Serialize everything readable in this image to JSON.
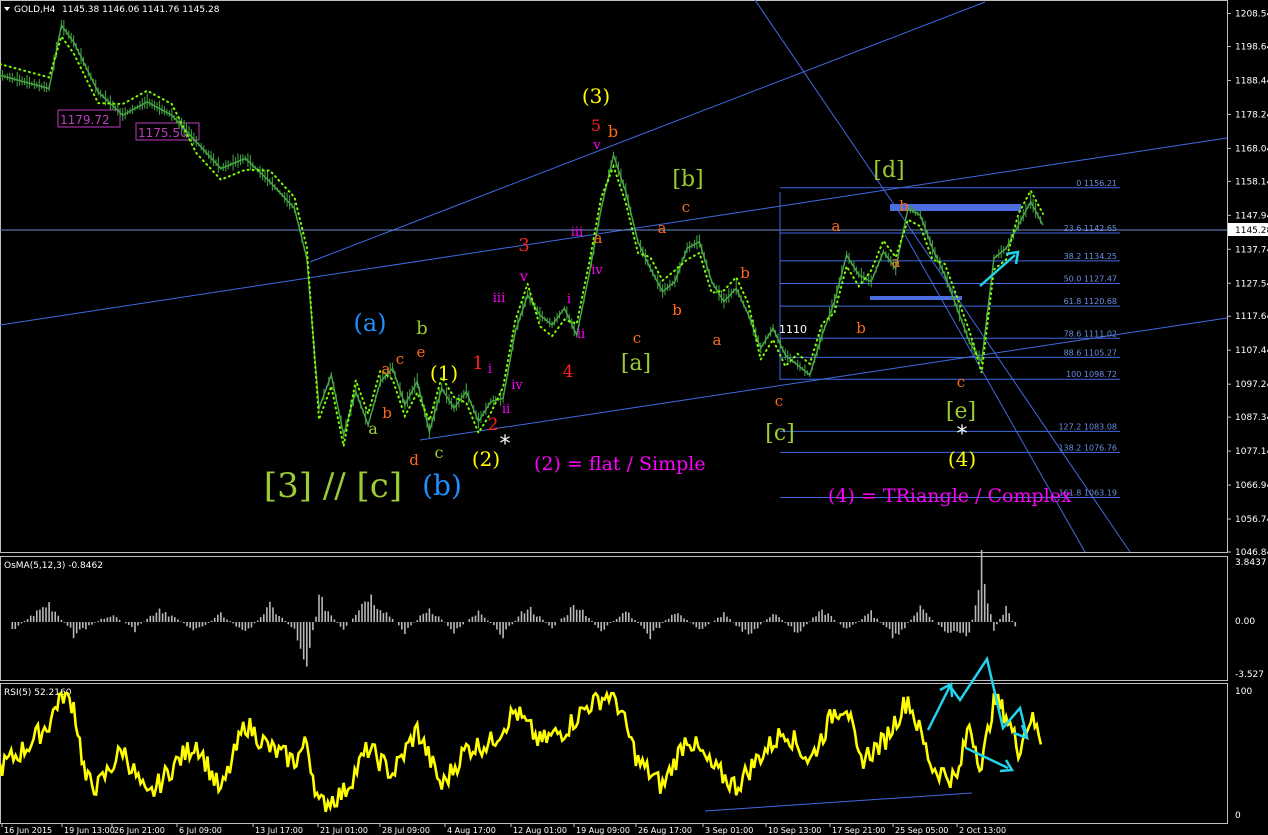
{
  "window": {
    "title": "GOLD,H4",
    "ohlc": "1145.38 1146.06 1141.76 1145.28",
    "current_price": "1145.28"
  },
  "price_axis": {
    "ticks": [
      "1208.54",
      "1198.64",
      "1188.44",
      "1178.24",
      "1168.04",
      "1158.14",
      "1147.94",
      "1137.74",
      "1127.54",
      "1117.64",
      "1107.44",
      "1097.24",
      "1087.34",
      "1077.14",
      "1066.94",
      "1056.74",
      "1046.84"
    ]
  },
  "time_axis": {
    "ticks": [
      "16 Jun 2015",
      "19 Jun 13:00",
      "26 Jun 21:00",
      "6 Jul 09:00",
      "13 Jul 17:00",
      "21 Jul 01:00",
      "28 Jul 09:00",
      "4 Aug 17:00",
      "12 Aug 01:00",
      "19 Aug 09:00",
      "26 Aug 17:00",
      "3 Sep 01:00",
      "10 Sep 13:00",
      "17 Sep 21:00",
      "25 Sep 05:00",
      "2 Oct 13:00"
    ]
  },
  "price_boxes": [
    "1179.72",
    "1175.50"
  ],
  "fibonacci": [
    {
      "ratio": "0",
      "price": "1156.21"
    },
    {
      "ratio": "23.6",
      "price": "1142.65"
    },
    {
      "ratio": "38.2",
      "price": "1134.25"
    },
    {
      "ratio": "50.0",
      "price": "1127.47"
    },
    {
      "ratio": "61.8",
      "price": "1120.68"
    },
    {
      "ratio": "78.6",
      "price": "1111.02"
    },
    {
      "ratio": "88.6",
      "price": "1105.27"
    },
    {
      "ratio": "100",
      "price": "1098.72"
    },
    {
      "ratio": "127.2",
      "price": "1083.08"
    },
    {
      "ratio": "138.2",
      "price": "1076.76"
    },
    {
      "ratio": "161.8",
      "price": "1063.19"
    }
  ],
  "wave_labels": [
    {
      "text": "(3)",
      "color": "#ffff00"
    },
    {
      "text": "5",
      "color": "#ff2020"
    },
    {
      "text": "b",
      "color": "#ff6a1a"
    },
    {
      "text": "v",
      "color": "#ff00ff"
    },
    {
      "text": "[b]",
      "color": "#9acd32"
    },
    {
      "text": "c",
      "color": "#ff6a1a"
    },
    {
      "text": "[d]",
      "color": "#9acd32"
    },
    {
      "text": "b",
      "color": "#ff6a1a"
    },
    {
      "text": "3",
      "color": "#ff2020"
    },
    {
      "text": "iii",
      "color": "#ff00ff"
    },
    {
      "text": "a",
      "color": "#ff6a1a"
    },
    {
      "text": "a",
      "color": "#ff6a1a"
    },
    {
      "text": "a",
      "color": "#ff6a1a"
    },
    {
      "text": "v",
      "color": "#ff00ff"
    },
    {
      "text": "iv",
      "color": "#ff00ff"
    },
    {
      "text": "b",
      "color": "#ff6a1a"
    },
    {
      "text": "a",
      "color": "#ff6a1a"
    },
    {
      "text": "iii",
      "color": "#ff00ff"
    },
    {
      "text": "i",
      "color": "#ff00ff"
    },
    {
      "text": "ii",
      "color": "#ff00ff"
    },
    {
      "text": "1110",
      "color": "#ffffff"
    },
    {
      "text": "(a)",
      "color": "#1e90ff"
    },
    {
      "text": "b",
      "color": "#9acd32"
    },
    {
      "text": "b",
      "color": "#ff6a1a"
    },
    {
      "text": "c",
      "color": "#ff6a1a"
    },
    {
      "text": "e",
      "color": "#ff6a1a"
    },
    {
      "text": "a",
      "color": "#ff6a1a"
    },
    {
      "text": "(1)",
      "color": "#ffff00"
    },
    {
      "text": "1",
      "color": "#ff2020"
    },
    {
      "text": "i",
      "color": "#ff00ff"
    },
    {
      "text": "c",
      "color": "#ff6a1a"
    },
    {
      "text": "[a]",
      "color": "#9acd32"
    },
    {
      "text": "b",
      "color": "#ff6a1a"
    },
    {
      "text": "a",
      "color": "#ff6a1a"
    },
    {
      "text": "4",
      "color": "#ff2020"
    },
    {
      "text": "iv",
      "color": "#ff00ff"
    },
    {
      "text": "b",
      "color": "#ff6a1a"
    },
    {
      "text": "a",
      "color": "#9acd32"
    },
    {
      "text": "ii",
      "color": "#ff00ff"
    },
    {
      "text": "2",
      "color": "#ff2020"
    },
    {
      "text": "c",
      "color": "#ff6a1a"
    },
    {
      "text": "[e]",
      "color": "#9acd32"
    },
    {
      "text": "c",
      "color": "#ff6a1a"
    },
    {
      "text": "[c]",
      "color": "#9acd32"
    },
    {
      "text": "d",
      "color": "#ff6a1a"
    },
    {
      "text": "c",
      "color": "#9acd32"
    },
    {
      "text": "(2)",
      "color": "#ffff00"
    },
    {
      "text": "(4)",
      "color": "#ffff00"
    },
    {
      "text": "[3] // [c]",
      "color": "#9acd32"
    },
    {
      "text": "(b)",
      "color": "#1e90ff"
    }
  ],
  "annotations": [
    {
      "text": "(2) = flat / Simple",
      "color": "#ff00ff"
    },
    {
      "text": "(4) = TRiangle / Complex",
      "color": "#ff00ff"
    }
  ],
  "osma": {
    "label": "OsMA(5,12,3) -0.8462",
    "ticks": [
      "3.8437",
      "0.00",
      "-3.527"
    ]
  },
  "rsi": {
    "label": "RSI(5) 52.2160",
    "ticks": [
      "100",
      "0"
    ]
  },
  "chart_data": {
    "type": "line",
    "symbol": "GOLD",
    "timeframe": "H4",
    "ylim": [
      1046.84,
      1212
    ],
    "price_path": [
      [
        0,
        1190
      ],
      [
        0.02,
        1188
      ],
      [
        0.04,
        1186
      ],
      [
        0.05,
        1205
      ],
      [
        0.06,
        1200
      ],
      [
        0.08,
        1185
      ],
      [
        0.1,
        1178
      ],
      [
        0.12,
        1182
      ],
      [
        0.14,
        1178
      ],
      [
        0.16,
        1170
      ],
      [
        0.18,
        1162
      ],
      [
        0.2,
        1165
      ],
      [
        0.22,
        1158
      ],
      [
        0.24,
        1150
      ],
      [
        0.25,
        1135
      ],
      [
        0.26,
        1090
      ],
      [
        0.27,
        1100
      ],
      [
        0.28,
        1082
      ],
      [
        0.29,
        1095
      ],
      [
        0.3,
        1085
      ],
      [
        0.31,
        1098
      ],
      [
        0.32,
        1102
      ],
      [
        0.33,
        1091
      ],
      [
        0.34,
        1098
      ],
      [
        0.35,
        1083
      ],
      [
        0.36,
        1096
      ],
      [
        0.37,
        1090
      ],
      [
        0.38,
        1095
      ],
      [
        0.39,
        1086
      ],
      [
        0.4,
        1092
      ],
      [
        0.41,
        1093
      ],
      [
        0.42,
        1113
      ],
      [
        0.43,
        1124
      ],
      [
        0.44,
        1118
      ],
      [
        0.45,
        1115
      ],
      [
        0.46,
        1120
      ],
      [
        0.47,
        1112
      ],
      [
        0.48,
        1130
      ],
      [
        0.49,
        1150
      ],
      [
        0.5,
        1166
      ],
      [
        0.51,
        1155
      ],
      [
        0.52,
        1140
      ],
      [
        0.53,
        1132
      ],
      [
        0.54,
        1125
      ],
      [
        0.55,
        1128
      ],
      [
        0.56,
        1138
      ],
      [
        0.57,
        1140
      ],
      [
        0.58,
        1128
      ],
      [
        0.59,
        1122
      ],
      [
        0.6,
        1126
      ],
      [
        0.61,
        1118
      ],
      [
        0.62,
        1108
      ],
      [
        0.63,
        1114
      ],
      [
        0.64,
        1106
      ],
      [
        0.65,
        1103
      ],
      [
        0.66,
        1100
      ],
      [
        0.67,
        1112
      ],
      [
        0.68,
        1122
      ],
      [
        0.69,
        1136
      ],
      [
        0.7,
        1130
      ],
      [
        0.71,
        1128
      ],
      [
        0.72,
        1137
      ],
      [
        0.73,
        1132
      ],
      [
        0.74,
        1150
      ],
      [
        0.75,
        1148
      ],
      [
        0.76,
        1138
      ],
      [
        0.77,
        1130
      ],
      [
        0.78,
        1120
      ],
      [
        0.79,
        1110
      ],
      [
        0.8,
        1104
      ],
      [
        0.81,
        1135
      ],
      [
        0.82,
        1138
      ],
      [
        0.83,
        1145
      ],
      [
        0.84,
        1152
      ],
      [
        0.85,
        1145
      ]
    ],
    "osma_path": [
      [
        0.01,
        -0.5
      ],
      [
        0.04,
        1.2
      ],
      [
        0.06,
        -0.8
      ],
      [
        0.09,
        0.5
      ],
      [
        0.11,
        -0.5
      ],
      [
        0.13,
        0.9
      ],
      [
        0.16,
        -0.6
      ],
      [
        0.18,
        0.5
      ],
      [
        0.2,
        -0.7
      ],
      [
        0.22,
        1.0
      ],
      [
        0.24,
        -0.5
      ],
      [
        0.25,
        -2.5
      ],
      [
        0.26,
        1.5
      ],
      [
        0.28,
        -0.6
      ],
      [
        0.3,
        1.8
      ],
      [
        0.33,
        -0.6
      ],
      [
        0.35,
        0.9
      ],
      [
        0.37,
        -0.6
      ],
      [
        0.39,
        0.6
      ],
      [
        0.41,
        -0.8
      ],
      [
        0.43,
        1.0
      ],
      [
        0.45,
        -0.4
      ],
      [
        0.47,
        1.2
      ],
      [
        0.49,
        -0.6
      ],
      [
        0.51,
        0.8
      ],
      [
        0.53,
        -0.9
      ],
      [
        0.55,
        0.7
      ],
      [
        0.57,
        -0.5
      ],
      [
        0.59,
        0.5
      ],
      [
        0.61,
        -0.9
      ],
      [
        0.63,
        0.6
      ],
      [
        0.65,
        -0.7
      ],
      [
        0.67,
        0.8
      ],
      [
        0.69,
        -0.5
      ],
      [
        0.71,
        0.6
      ],
      [
        0.73,
        -1.1
      ],
      [
        0.75,
        1.0
      ],
      [
        0.77,
        -0.6
      ],
      [
        0.79,
        -0.9
      ],
      [
        0.8,
        3.6
      ],
      [
        0.81,
        -0.5
      ],
      [
        0.82,
        0.8
      ],
      [
        0.83,
        -0.6
      ]
    ],
    "rsi_path": [
      [
        0,
        40
      ],
      [
        0.02,
        55
      ],
      [
        0.04,
        75
      ],
      [
        0.05,
        100
      ],
      [
        0.06,
        90
      ],
      [
        0.07,
        30
      ],
      [
        0.08,
        25
      ],
      [
        0.1,
        55
      ],
      [
        0.12,
        15
      ],
      [
        0.14,
        40
      ],
      [
        0.16,
        60
      ],
      [
        0.18,
        20
      ],
      [
        0.2,
        75
      ],
      [
        0.22,
        55
      ],
      [
        0.24,
        45
      ],
      [
        0.25,
        60
      ],
      [
        0.26,
        10
      ],
      [
        0.28,
        20
      ],
      [
        0.3,
        55
      ],
      [
        0.32,
        35
      ],
      [
        0.34,
        70
      ],
      [
        0.36,
        25
      ],
      [
        0.38,
        55
      ],
      [
        0.4,
        60
      ],
      [
        0.42,
        85
      ],
      [
        0.44,
        60
      ],
      [
        0.46,
        70
      ],
      [
        0.48,
        90
      ],
      [
        0.5,
        100
      ],
      [
        0.52,
        45
      ],
      [
        0.54,
        25
      ],
      [
        0.56,
        65
      ],
      [
        0.58,
        40
      ],
      [
        0.6,
        25
      ],
      [
        0.62,
        50
      ],
      [
        0.64,
        70
      ],
      [
        0.66,
        45
      ],
      [
        0.68,
        85
      ],
      [
        0.69,
        90
      ],
      [
        0.7,
        45
      ],
      [
        0.72,
        60
      ],
      [
        0.74,
        95
      ],
      [
        0.76,
        40
      ],
      [
        0.78,
        30
      ],
      [
        0.79,
        75
      ],
      [
        0.8,
        40
      ],
      [
        0.81,
        95
      ],
      [
        0.82,
        82
      ],
      [
        0.83,
        55
      ],
      [
        0.84,
        80
      ],
      [
        0.85,
        60
      ]
    ]
  }
}
